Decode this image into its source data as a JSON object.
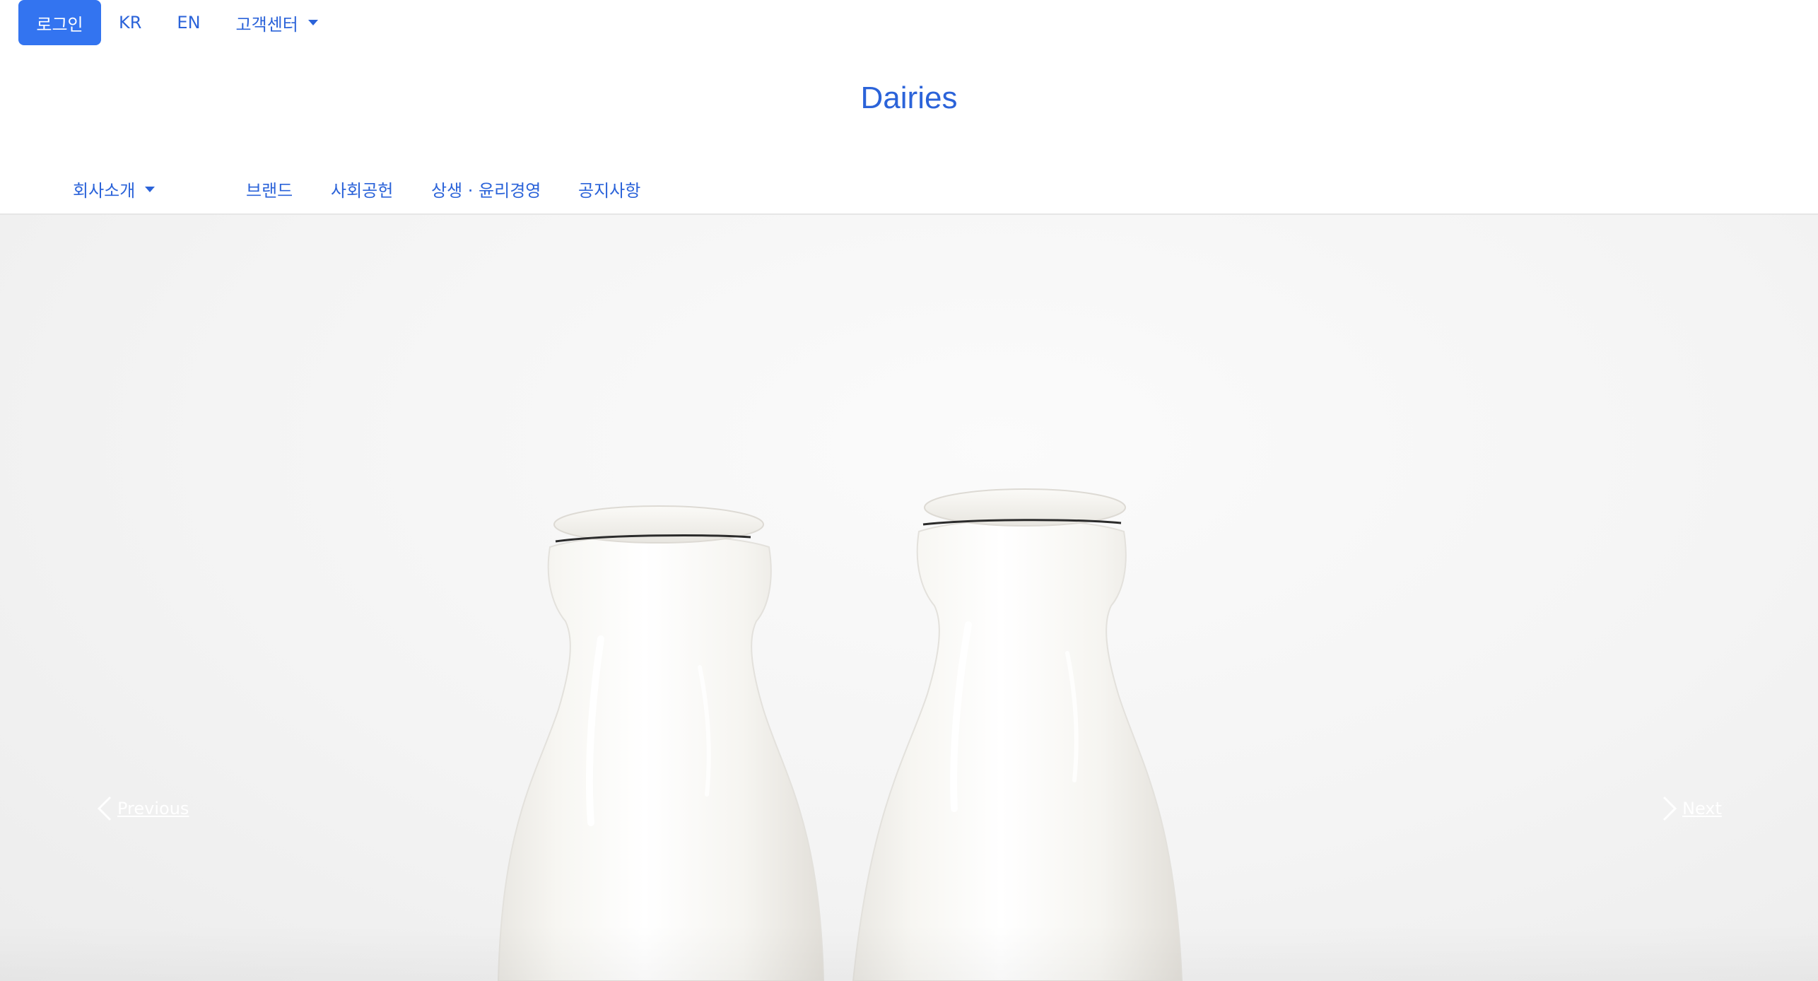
{
  "topbar": {
    "login_label": "로그인",
    "lang_kr": "KR",
    "lang_en": "EN",
    "customer_center_label": "고객센터"
  },
  "brand": {
    "title": "Dairies"
  },
  "mainnav": {
    "items": [
      {
        "label": "회사소개",
        "has_dropdown": true
      },
      {
        "label": "브랜드"
      },
      {
        "label": "사회공헌"
      },
      {
        "label": "상생 · 윤리경영"
      },
      {
        "label": "공지사항"
      }
    ]
  },
  "carousel": {
    "prev_label": "Previous",
    "next_label": "Next"
  },
  "colors": {
    "accent": "#3374f0",
    "link": "#2b63d9",
    "divider": "#e6e6e6"
  }
}
